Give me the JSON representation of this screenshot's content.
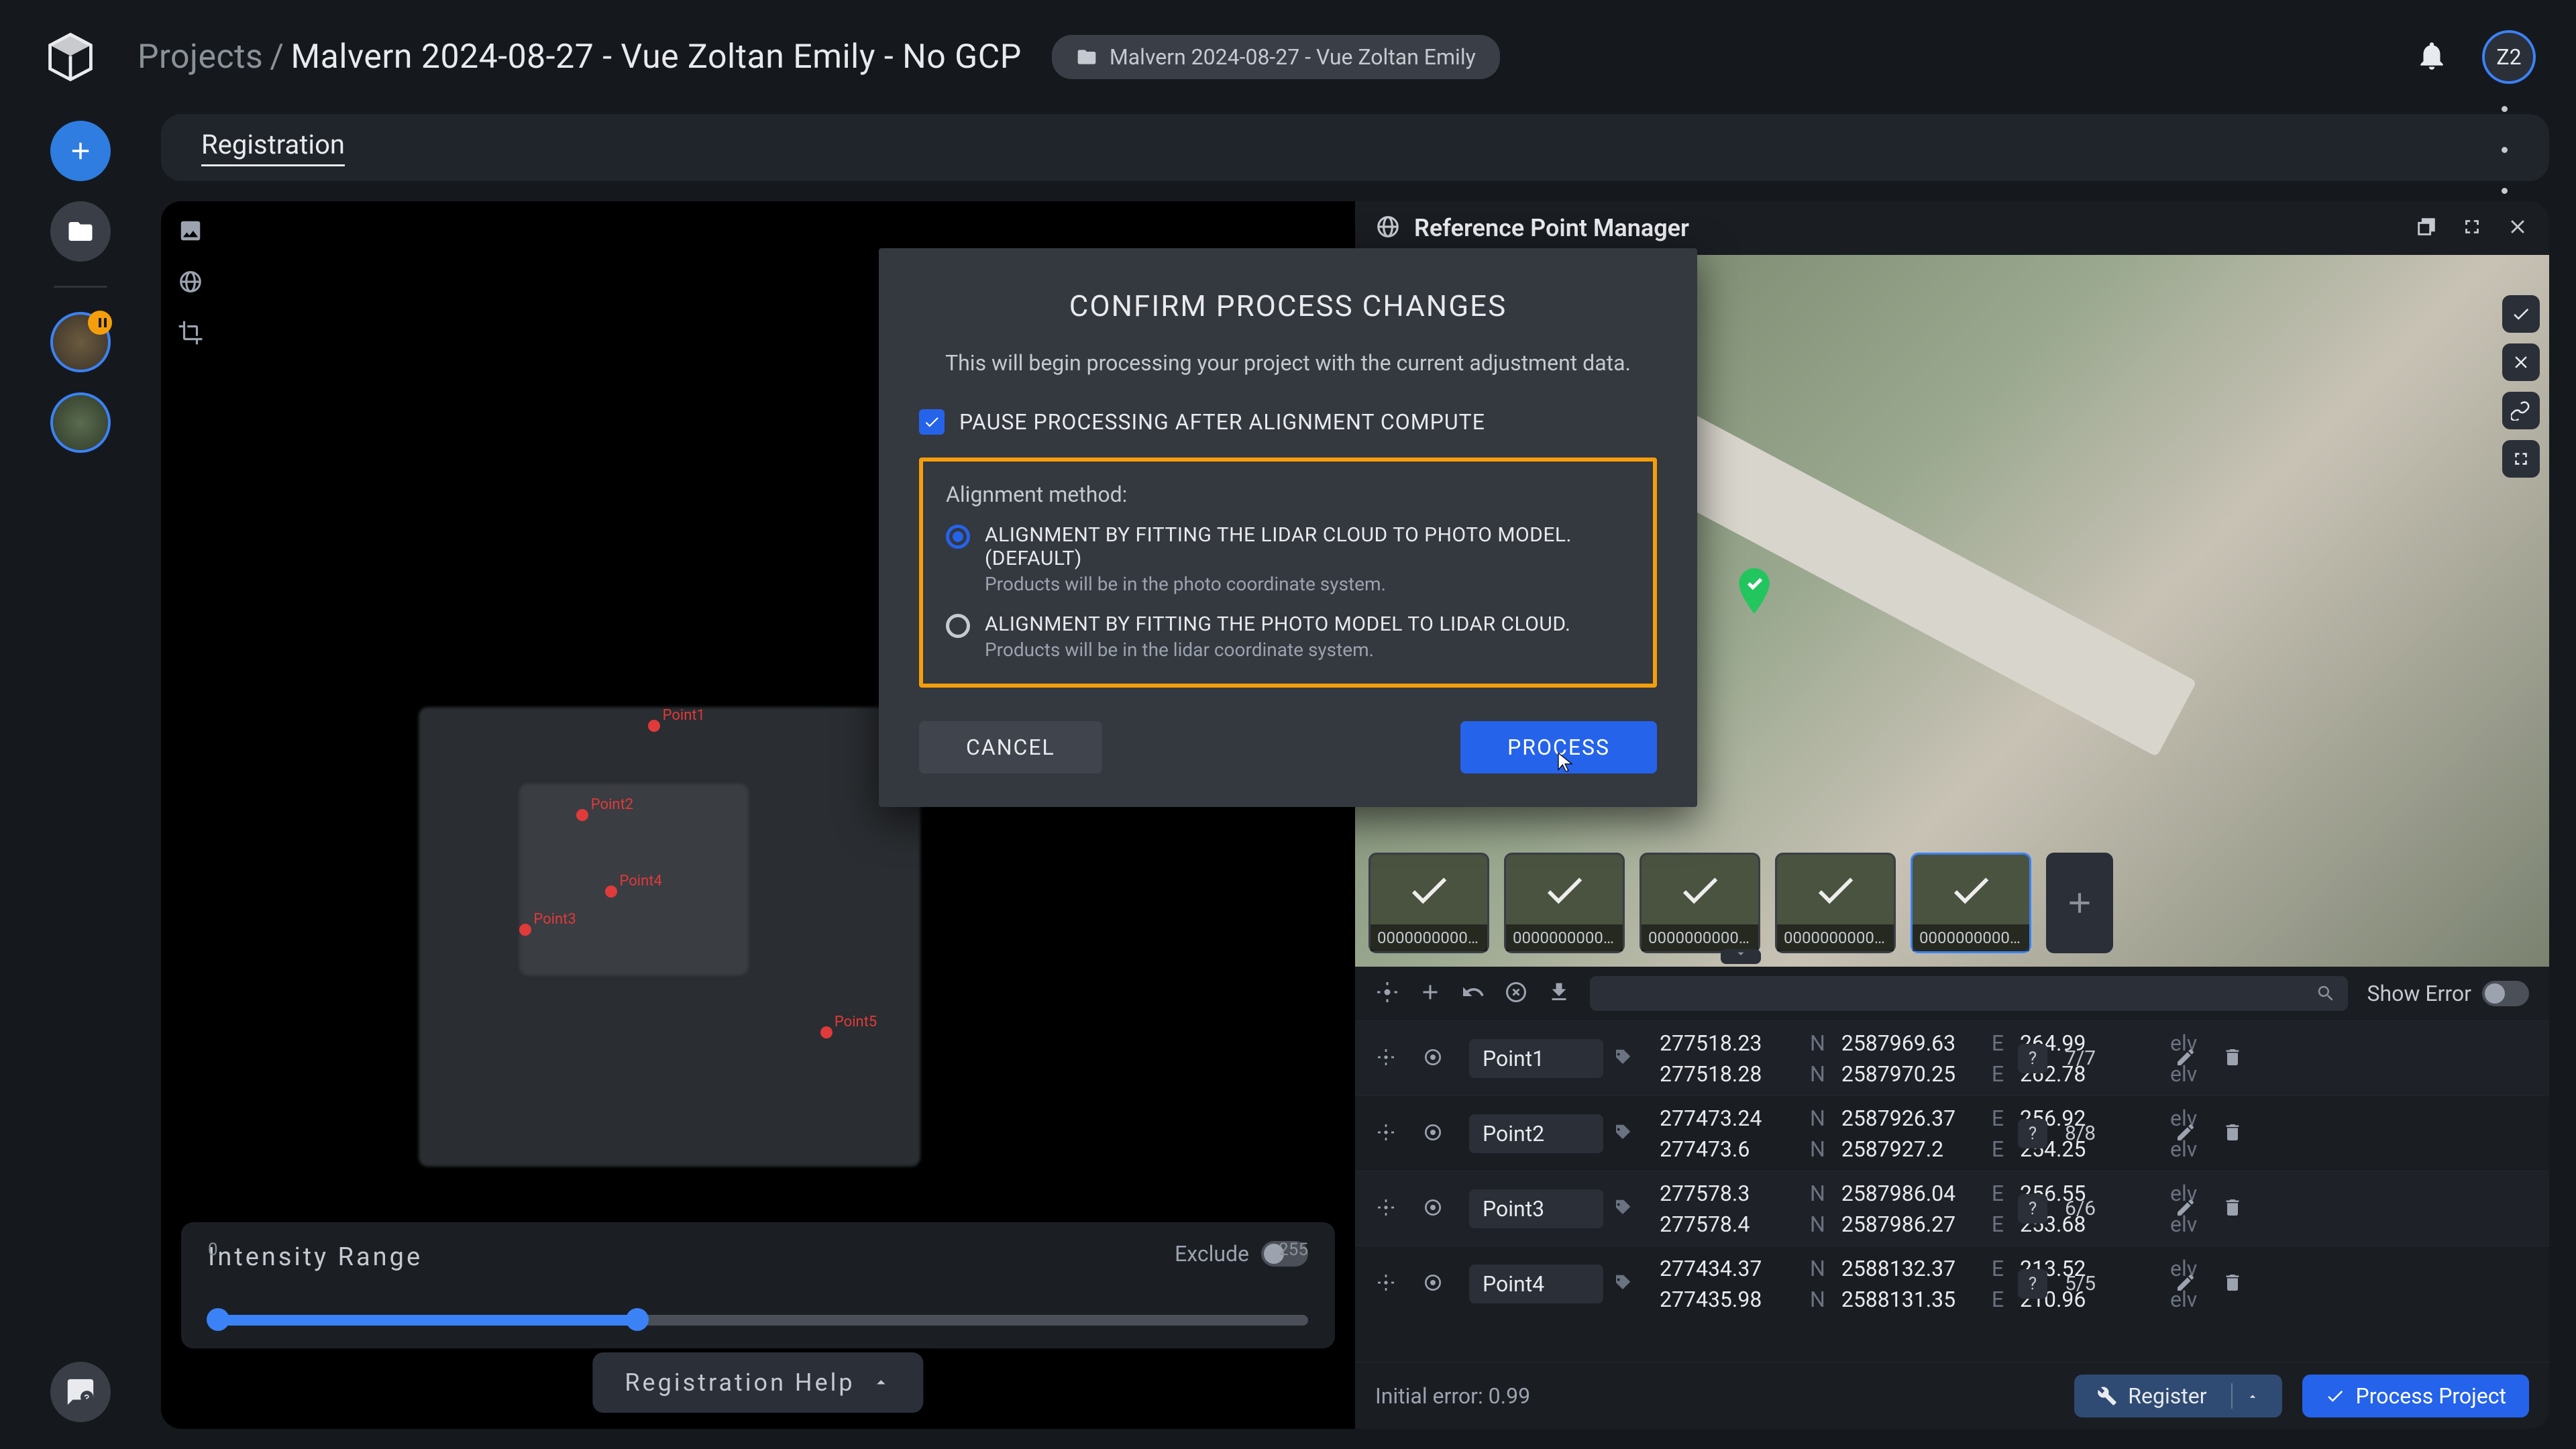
{
  "breadcrumb": {
    "projects": "Projects",
    "current": "Malvern 2024-08-27 - Vue Zoltan Emily - No GCP"
  },
  "folder_chip": "Malvern 2024-08-27 - Vue Zoltan Emily",
  "avatar_initials": "Z2",
  "active_tab": "Registration",
  "intensity": {
    "title": "Intensity Range",
    "exclude_label": "Exclude",
    "min": "0",
    "max": "255"
  },
  "reg_help": "Registration Help",
  "rpm": {
    "title": "Reference Point Manager",
    "thumbs": [
      "0000000000…",
      "0000000000…",
      "0000000000…",
      "0000000000…",
      "0000000000…"
    ],
    "show_error": "Show Error",
    "points": [
      {
        "name": "Point1",
        "r1": {
          "x": "277518.23",
          "xl": "N",
          "y": "2587969.63",
          "yl": "E",
          "z": "264.99",
          "zl": "elv"
        },
        "r2": {
          "x": "277518.28",
          "xl": "N",
          "y": "2587970.25",
          "yl": "E",
          "z": "262.78",
          "zl": "elv"
        },
        "count": "7/7"
      },
      {
        "name": "Point2",
        "r1": {
          "x": "277473.24",
          "xl": "N",
          "y": "2587926.37",
          "yl": "E",
          "z": "256.92",
          "zl": "elv"
        },
        "r2": {
          "x": "277473.6",
          "xl": "N",
          "y": "2587927.2",
          "yl": "E",
          "z": "254.25",
          "zl": "elv"
        },
        "count": "8/8"
      },
      {
        "name": "Point3",
        "r1": {
          "x": "277578.3",
          "xl": "N",
          "y": "2587986.04",
          "yl": "E",
          "z": "256.55",
          "zl": "elv"
        },
        "r2": {
          "x": "277578.4",
          "xl": "N",
          "y": "2587986.27",
          "yl": "E",
          "z": "253.68",
          "zl": "elv"
        },
        "count": "6/6"
      },
      {
        "name": "Point4",
        "r1": {
          "x": "277434.37",
          "xl": "N",
          "y": "2588132.37",
          "yl": "E",
          "z": "213.52",
          "zl": "elv"
        },
        "r2": {
          "x": "277435.98",
          "xl": "N",
          "y": "2588131.35",
          "yl": "E",
          "z": "210.96",
          "zl": "elv"
        },
        "count": "5/5"
      }
    ],
    "initial_error": "Initial error: 0.99",
    "register_btn": "Register",
    "process_btn": "Process Project"
  },
  "modal": {
    "title": "CONFIRM PROCESS CHANGES",
    "desc": "This will begin processing your project with the current adjustment data.",
    "pause_label": "PAUSE PROCESSING AFTER ALIGNMENT COMPUTE",
    "align_header": "Alignment method:",
    "opt1_title": "ALIGNMENT BY FITTING THE LIDAR CLOUD TO PHOTO MODEL. (DEFAULT)",
    "opt1_sub": "Products will be in the photo coordinate system.",
    "opt2_title": "ALIGNMENT BY FITTING THE PHOTO MODEL TO LIDAR CLOUD.",
    "opt2_sub": "Products will be in the lidar coordinate system.",
    "cancel": "CANCEL",
    "process": "PROCESS"
  },
  "pc_points": [
    "Point1",
    "Point2",
    "Point3",
    "Point4",
    "Point5"
  ]
}
